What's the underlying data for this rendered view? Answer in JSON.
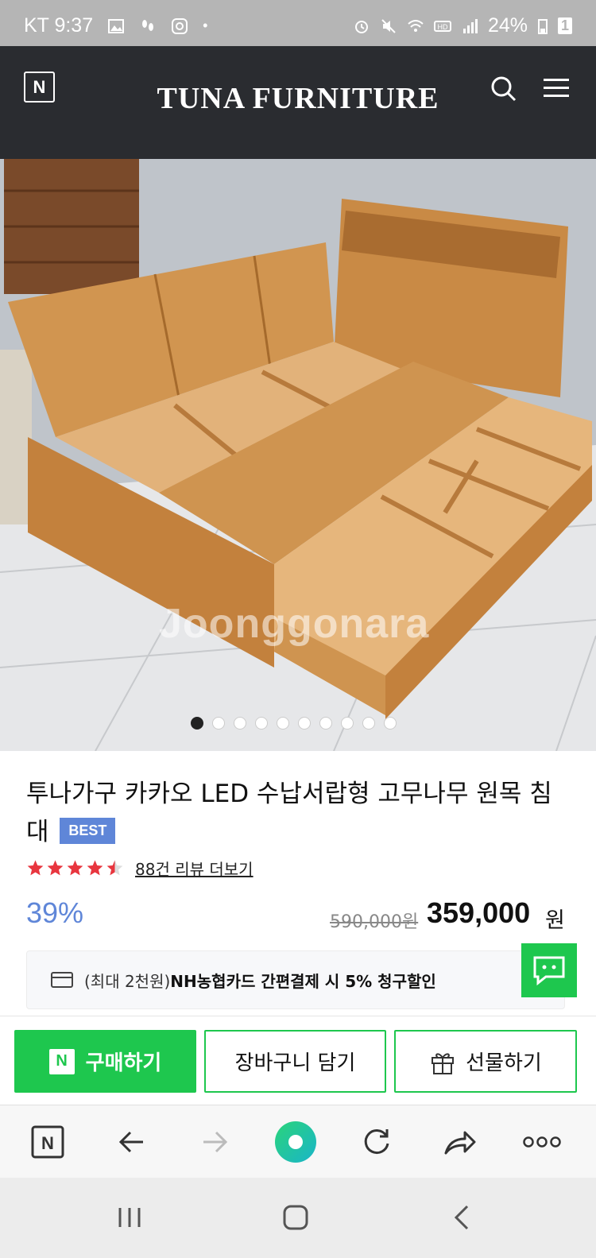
{
  "status_bar": {
    "carrier_time": "KT 9:37",
    "battery": "24%",
    "sim_slot": "1"
  },
  "header": {
    "logo_letter": "N",
    "brand": "TUNA FURNITURE"
  },
  "product": {
    "watermark": "Joonggonara",
    "image_dots": {
      "count": 10,
      "active_index": 0
    },
    "title": "투나가구 카카오 LED 수납서랍형 고무나무 원목 침대",
    "badge": "BEST",
    "rating": {
      "stars": 4.5,
      "max": 5
    },
    "review_link": "88건 리뷰 더보기",
    "discount": "39%",
    "original_price": "590,000원",
    "sale_price": "359,000",
    "currency": "원"
  },
  "card_banner": {
    "prefix": "(최대 2천원)",
    "highlight": "NH농협카드 간편결제 시 5% 청구할인"
  },
  "actions": {
    "buy_icon": "N",
    "buy_label": "구매하기",
    "cart_label": "장바구니 담기",
    "gift_label": "선물하기"
  },
  "browser_toolbar": {
    "items": [
      "home-icon",
      "back-icon",
      "forward-icon",
      "green-dot-icon",
      "refresh-icon",
      "share-icon",
      "more-icon"
    ]
  },
  "system_nav": {
    "items": [
      "recents-icon",
      "home-icon",
      "back-icon"
    ]
  },
  "colors": {
    "accent_green": "#1ec74e",
    "discount_blue": "#5f86d8",
    "header_dark": "#2a2c30",
    "star_red": "#e8363f"
  }
}
